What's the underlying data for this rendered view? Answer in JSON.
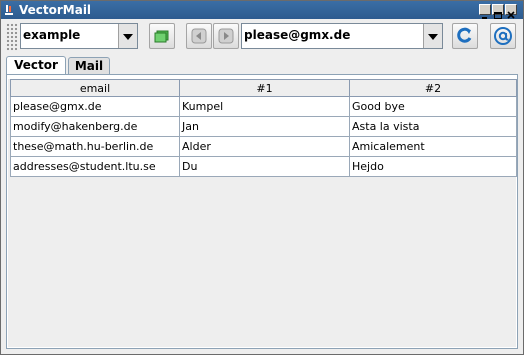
{
  "window": {
    "title": "VectorMail"
  },
  "toolbar": {
    "profile_combo": "example",
    "email_combo": "please@gmx.de"
  },
  "tabs": [
    {
      "label": "Vector",
      "active": true
    },
    {
      "label": "Mail",
      "active": false
    }
  ],
  "table": {
    "headers": [
      "email",
      "#1",
      "#2"
    ],
    "rows": [
      [
        "please@gmx.de",
        "Kumpel",
        "Good bye"
      ],
      [
        "modify@hakenberg.de",
        "Jan",
        "Asta la vista"
      ],
      [
        "these@math.hu-berlin.de",
        "Alder",
        "Amicalement"
      ],
      [
        "addresses@student.ltu.se",
        "Du",
        "Hejdo"
      ]
    ]
  },
  "colors": {
    "titlebar": "#3a6ea5",
    "accent": "#1e6fbf"
  }
}
